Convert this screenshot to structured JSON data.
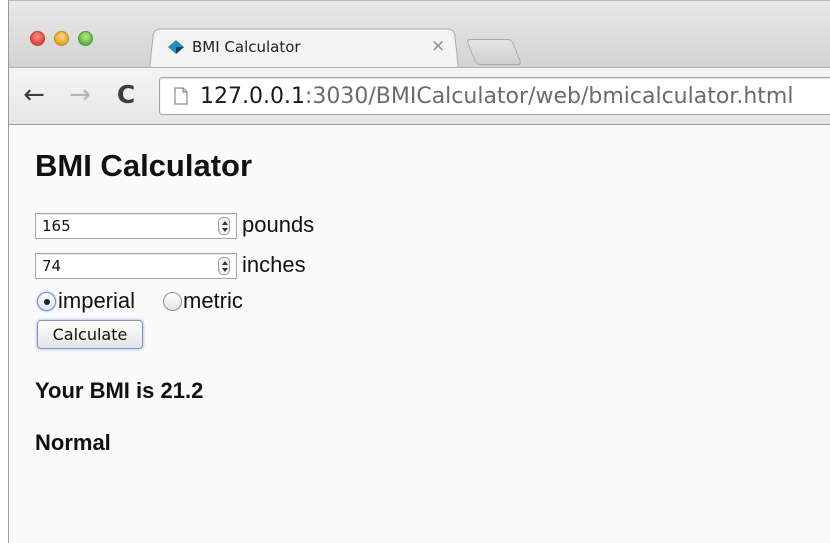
{
  "browser": {
    "tab_title": "BMI Calculator",
    "tab_close": "×",
    "url_host": "127.0.0.1",
    "url_rest": ":3030/BMICalculator/web/bmicalculator.html",
    "nav_back": "←",
    "nav_forward": "→",
    "nav_reload": "C"
  },
  "page": {
    "title": "BMI Calculator",
    "weight": {
      "value": "165",
      "unit": "pounds"
    },
    "height": {
      "value": "74",
      "unit": "inches"
    },
    "units": {
      "options": [
        "imperial",
        "metric"
      ],
      "selected": "imperial"
    },
    "calculate_label": "Calculate",
    "result_text": "Your BMI is 21.2",
    "category_text": "Normal"
  },
  "colors": {
    "favicon_teal": "#1f8fb8",
    "favicon_dark": "#1b3c6b",
    "focus_ring": "#86aee6"
  }
}
